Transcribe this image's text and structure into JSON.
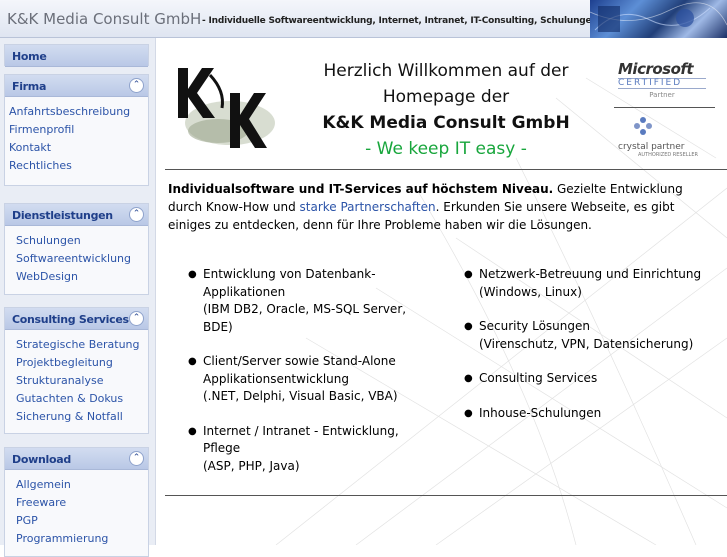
{
  "header": {
    "title": "K&K Media Consult GmbH",
    "tagline": "- Individuelle Softwareentwicklung, Internet, Intranet, IT-Consulting, Schulungen"
  },
  "sidebar": {
    "home": "Home",
    "sections": [
      {
        "label": "Firma",
        "items": [
          "Anfahrtsbeschreibung",
          "Firmenprofil",
          "Kontakt",
          "Rechtliches"
        ]
      },
      {
        "label": "Dienstleistungen",
        "items": [
          "Schulungen",
          "Softwareentwicklung",
          "WebDesign"
        ]
      },
      {
        "label": "Consulting Services",
        "items": [
          "Strategische Beratung",
          "Projektbegleitung",
          "Strukturanalyse",
          "Gutachten & Dokus",
          "Sicherung & Notfall"
        ]
      },
      {
        "label": "Download",
        "items": [
          "Allgemein",
          "Freeware",
          "PGP",
          "Programmierung"
        ]
      }
    ],
    "collapse_glyph": "⌃"
  },
  "main": {
    "welcome_line1": "Herzlich Willkommen auf der",
    "welcome_line2": "Homepage der",
    "welcome_company": "K&K Media Consult GmbH",
    "welcome_slogan": "- We keep IT easy -",
    "partners": {
      "ms_word": "Microsoft",
      "ms_cert": "CERTIFIED",
      "ms_partner": "Partner",
      "crystal_word": "crystal partner",
      "crystal_sub": "AUTHORIZED RESELLER"
    },
    "intro_bold": "Individualsoftware und IT-Services auf höchstem Niveau.",
    "intro_part1": " Gezielte Entwicklung durch Know-How und ",
    "intro_link": "starke Partnerschaften",
    "intro_part2": ". Erkunden Sie unsere Webseite, es gibt einiges zu entdecken, denn für Ihre Probleme haben wir die Lösungen.",
    "services_left": [
      {
        "title": "Entwicklung von Datenbank-Applikationen",
        "detail": "(IBM DB2, Oracle, MS-SQL Server, BDE)"
      },
      {
        "title": "Client/Server sowie Stand-Alone Applikationsentwicklung",
        "detail": "(.NET, Delphi, Visual Basic, VBA)"
      },
      {
        "title": "Internet / Intranet - Entwicklung, Pflege",
        "detail": "(ASP, PHP, Java)"
      }
    ],
    "services_right": [
      {
        "title": "Netzwerk-Betreuung und Einrichtung",
        "detail": "(Windows, Linux)"
      },
      {
        "title": "Security Lösungen",
        "detail": "(Virenschutz, VPN, Datensicherung)"
      },
      {
        "title": "Consulting Services",
        "detail": ""
      },
      {
        "title": "Inhouse-Schulungen",
        "detail": ""
      }
    ],
    "bullet": "●"
  }
}
